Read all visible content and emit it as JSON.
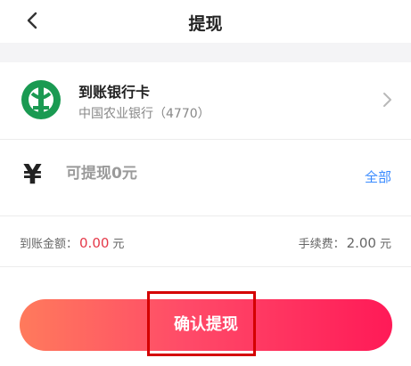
{
  "header": {
    "title": "提现",
    "back_icon": "chevron-left-icon"
  },
  "bank": {
    "title": "到账银行卡",
    "subtitle": "中国农业银行（4770）",
    "logo_icon": "abc-bank-logo-icon",
    "logo_color": "#1a9a52"
  },
  "amount": {
    "currency_symbol": "¥",
    "placeholder": "可提现0元",
    "value": "",
    "all_label": "全部"
  },
  "fees": {
    "arrival_label": "到账金额：",
    "arrival_value": "0.00",
    "arrival_unit": "元",
    "fee_label": "手续费：",
    "fee_value": "2.00",
    "fee_unit": "元"
  },
  "confirm_label": "确认提现",
  "colors": {
    "accent_blue": "#3a8bff",
    "accent_red": "#e53a4a",
    "button_from": "#ff7a5c",
    "button_to": "#ff1a57"
  }
}
